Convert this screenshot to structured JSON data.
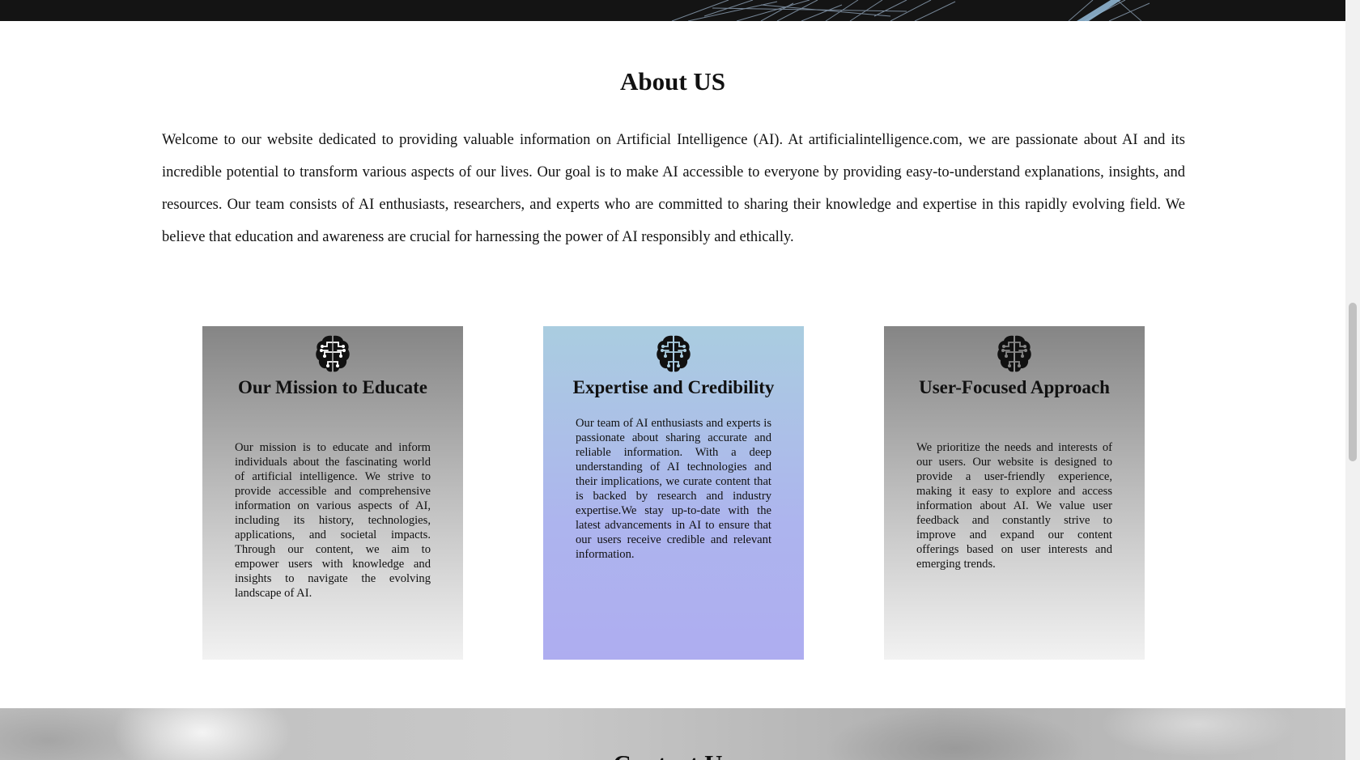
{
  "about": {
    "title": "About US",
    "text": "Welcome to our website dedicated to providing valuable information on Artificial Intelligence (AI). At artificialintelligence.com, we are passionate about AI and its incredible potential to transform various aspects of our lives. Our goal is to make AI accessible to everyone by providing easy-to-understand explanations, insights, and resources. Our team consists of AI enthusiasts, researchers, and experts who are committed to sharing their knowledge and expertise in this rapidly evolving field. We believe that education and awareness are crucial for harnessing the power of AI responsibly and ethically."
  },
  "cards": [
    {
      "icon": "brain-circuit-icon",
      "title": "Our Mission to Educate",
      "text": "Our mission is to educate and inform individuals about the fascinating world of artificial intelligence. We strive to provide accessible and comprehensive information on various aspects of AI, including its history, technologies, applications, and societal impacts. Through our content, we aim to empower users with knowledge and insights to navigate the evolving landscape of AI."
    },
    {
      "icon": "brain-circuit-icon",
      "title": "Expertise and Credibility",
      "text": "Our team of AI enthusiasts and experts is passionate about sharing accurate and reliable information. With a deep understanding of AI technologies and their implications, we curate content that is backed by research and industry expertise.We stay up-to-date with the latest advancements in AI to ensure that our users receive credible and relevant information."
    },
    {
      "icon": "brain-circuit-icon",
      "title": "User-Focused Approach",
      "text": "We prioritize the needs and interests of our users. Our website is designed to provide a user-friendly experience, making it easy to explore and access information about AI. We value user feedback and constantly strive to improve and expand our content offerings based on user interests and emerging trends."
    }
  ],
  "contact": {
    "title": "Contact Us"
  },
  "colors": {
    "banner": "#141414",
    "card_gray_top": "#858585",
    "card_blue_top": "#aacde0",
    "card_blue_bottom": "#aeadf0"
  }
}
